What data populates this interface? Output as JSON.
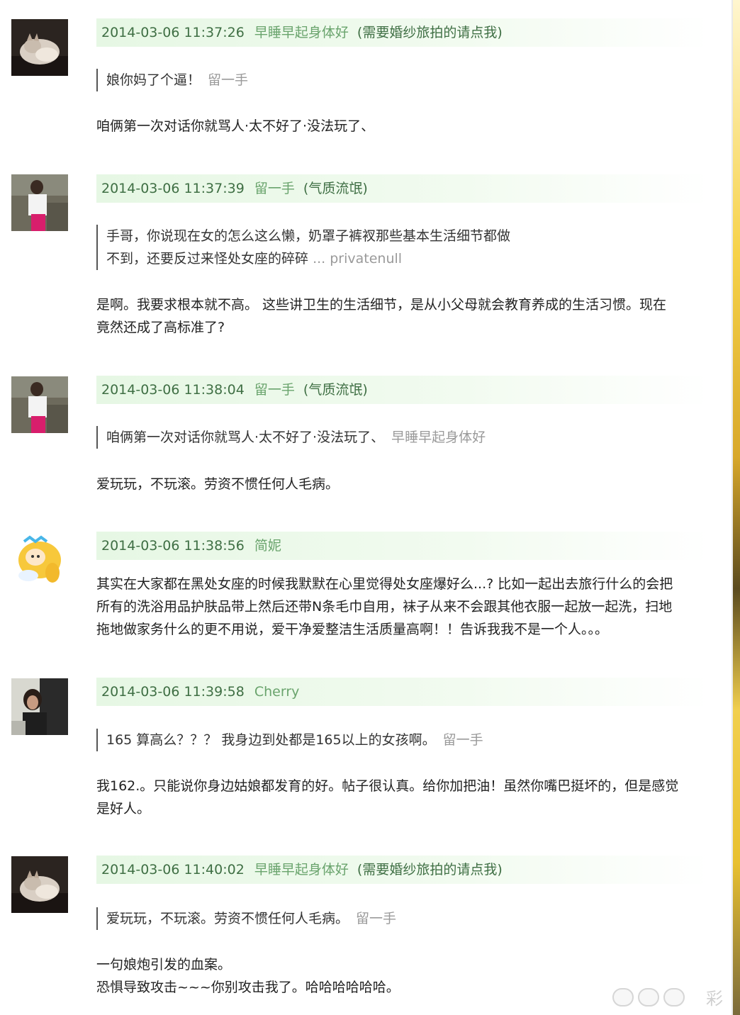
{
  "comments": [
    {
      "time": "2014-03-06 11:37:26",
      "user": "早睡早起身体好",
      "extra": "(需要婚纱旅拍的请点我)",
      "quote": {
        "text": "娘你妈了个逼！",
        "author": "留一手"
      },
      "body": [
        "咱俩第一次对话你就骂人·太不好了·没法玩了、"
      ]
    },
    {
      "time": "2014-03-06 11:37:39",
      "user": "留一手",
      "extra": "(气质流氓)",
      "quote": {
        "line1": "手哥，你说现在女的怎么这么懒，奶罩子裤衩那些基本生活细节都做",
        "line2": "不到，还要反过来怪处女座的碎碎",
        "ellipsis": "... privatenull"
      },
      "body": [
        "是啊。我要求根本就不高。 这些讲卫生的生活细节，是从小父母就会教育养成的生活习惯。现在",
        "竟然还成了高标准了?"
      ]
    },
    {
      "time": "2014-03-06 11:38:04",
      "user": "留一手",
      "extra": "(气质流氓)",
      "quote": {
        "text": "咱俩第一次对话你就骂人·太不好了·没法玩了、",
        "author": "早睡早起身体好"
      },
      "body": [
        "爱玩玩，不玩滚。劳资不惯任何人毛病。"
      ]
    },
    {
      "time": "2014-03-06 11:38:56",
      "user": "简妮",
      "extra": "",
      "body": [
        "其实在大家都在黑处女座的时候我默默在心里觉得处女座爆好么...? 比如一起出去旅行什么的会把",
        "所有的洗浴用品护肤品带上然后还带N条毛巾自用，袜子从来不会跟其他衣服一起放一起洗，扫地",
        "拖地做家务什么的更不用说，爱干净爱整洁生活质量高啊！！告诉我我不是一个人。。。"
      ]
    },
    {
      "time": "2014-03-06 11:39:58",
      "user": "Cherry",
      "extra": "",
      "quote": {
        "text": "165 算高么？？？ 我身边到处都是165以上的女孩啊。",
        "author": "留一手"
      },
      "body": [
        "我162.。只能说你身边姑娘都发育的好。帖子很认真。给你加把油！虽然你嘴巴挺坏的，但是感觉",
        "是好人。"
      ]
    },
    {
      "time": "2014-03-06 11:40:02",
      "user": "早睡早起身体好",
      "extra": "(需要婚纱旅拍的请点我)",
      "quote": {
        "text": "爱玩玩，不玩滚。劳资不惯任何人毛病。",
        "author": "留一手"
      },
      "body": [
        "一句娘炮引发的血案。",
        "恐惧导致攻击~~~你别攻击我了。哈哈哈哈哈哈。"
      ]
    }
  ],
  "watermark": "彩"
}
